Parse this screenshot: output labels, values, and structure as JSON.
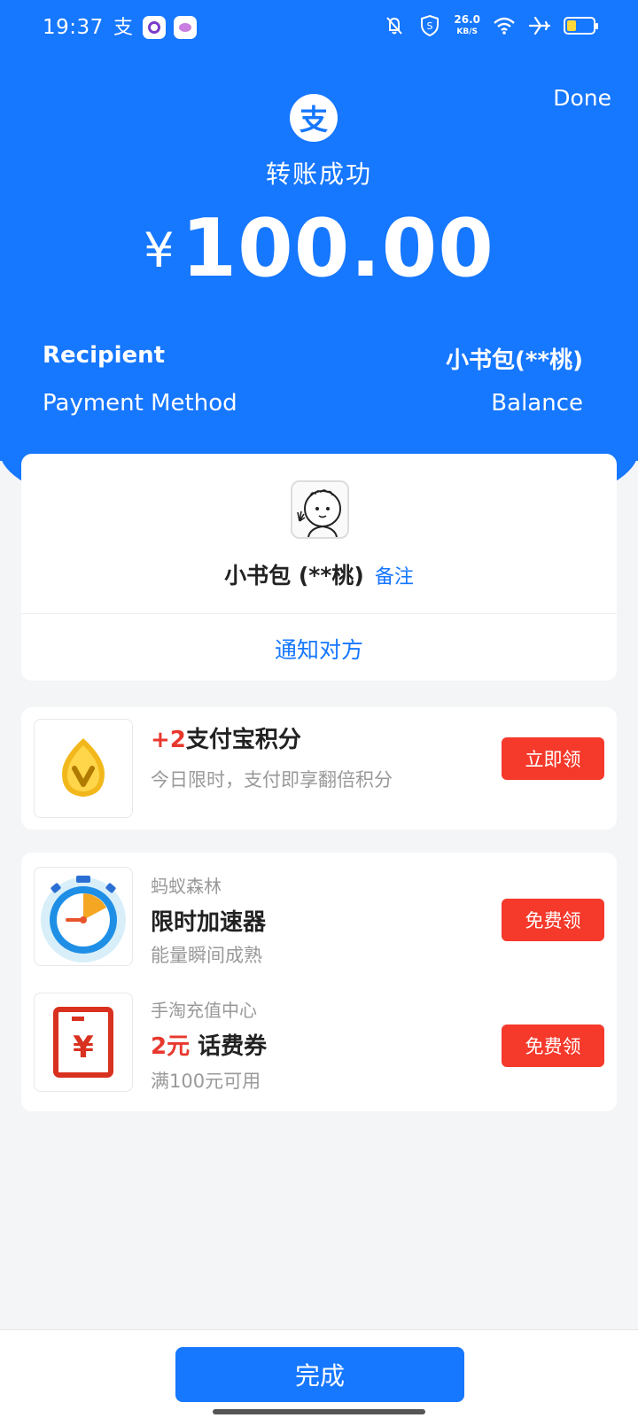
{
  "status_bar": {
    "time": "19:37",
    "app_icon_1": "支",
    "net_speed_value": "26.0",
    "net_speed_unit": "KB/S",
    "battery_level": 0.35,
    "battery_color": "#ffd83a"
  },
  "header": {
    "done_label": "Done",
    "logo_glyph": "支",
    "title": "转账成功",
    "currency": "¥",
    "amount": "100.00"
  },
  "details": {
    "recipient_label": "Recipient",
    "recipient_value": "小书包(**桃)",
    "method_label": "Payment Method",
    "method_value": "Balance"
  },
  "recipient_card": {
    "name": "小书包 (**桃)",
    "remark_label": "备注",
    "notify_label": "通知对方"
  },
  "promo": {
    "accent": "+2",
    "title": "支付宝积分",
    "subtitle": "今日限时，支付即享翻倍积分",
    "button": "立即领"
  },
  "offers": [
    {
      "tag": "蚂蚁森林",
      "title": "限时加速器",
      "subtitle": "能量瞬间成熟",
      "button": "免费领"
    },
    {
      "tag": "手淘充值中心",
      "accent": "2元",
      "title": "话费券",
      "subtitle": "满100元可用",
      "button": "免费领"
    }
  ],
  "footer": {
    "complete_label": "完成"
  },
  "colors": {
    "brand_blue": "#1677ff",
    "accent_red": "#f5392b"
  }
}
